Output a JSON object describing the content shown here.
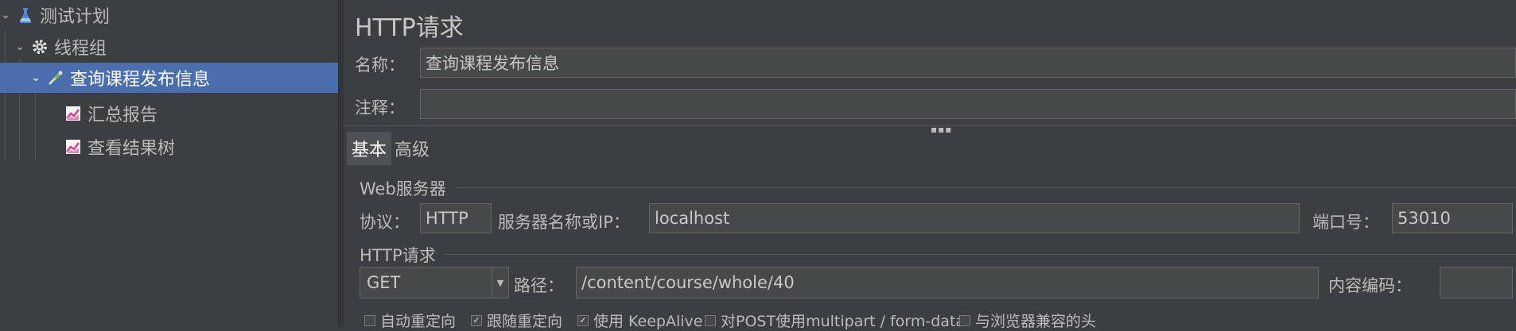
{
  "tree": {
    "items": [
      {
        "label": "测试计划",
        "icon": "flask-icon"
      },
      {
        "label": "线程组",
        "icon": "gear-icon"
      },
      {
        "label": "查询课程发布信息",
        "icon": "pipette-icon"
      },
      {
        "label": "汇总报告",
        "icon": "chart-icon"
      },
      {
        "label": "查看结果树",
        "icon": "chart-icon"
      }
    ]
  },
  "panel": {
    "title": "HTTP请求",
    "name_label": "名称：",
    "name_value": "查询课程发布信息",
    "comment_label": "注释：",
    "comment_value": ""
  },
  "tabs": [
    "基本",
    "高级"
  ],
  "web_server": {
    "group_title": "Web服务器",
    "protocol_label": "协议：",
    "protocol_value": "HTTP",
    "server_label": "服务器名称或IP：",
    "server_value": "localhost",
    "port_label": "端口号：",
    "port_value": "53010"
  },
  "http_request": {
    "group_title": "HTTP请求",
    "method": "GET",
    "path_label": "路径：",
    "path_value": "/content/course/whole/40",
    "encoding_label": "内容编码：",
    "encoding_value": ""
  },
  "options": [
    {
      "label": "自动重定向",
      "checked": false
    },
    {
      "label": "跟随重定向",
      "checked": true
    },
    {
      "label": "使用 KeepAlive",
      "checked": true
    },
    {
      "label": "对POST使用multipart / form-data",
      "checked": false
    },
    {
      "label": "与浏览器兼容的头",
      "checked": false
    }
  ],
  "colors": {
    "selection": "#4b6eaf",
    "background": "#3c3f41",
    "field": "#45494a"
  }
}
